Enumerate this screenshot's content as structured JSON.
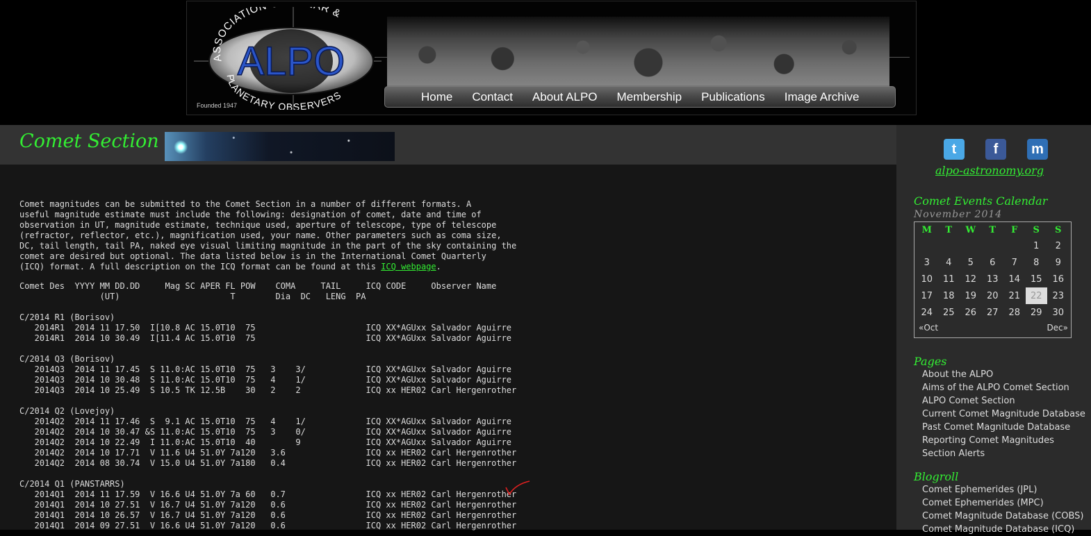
{
  "logo": {
    "arc_top": "ASSOCIATION OF LUNAR &",
    "arc_bottom": "PLANETARY OBSERVERS",
    "acronym": "ALPO",
    "founded": "Founded 1947"
  },
  "nav": {
    "items": [
      "Home",
      "Contact",
      "About ALPO",
      "Membership",
      "Publications",
      "Image Archive"
    ]
  },
  "section": {
    "title": "Comet Section"
  },
  "intro": {
    "text": "Comet magnitudes can be submitted to the Comet Section in a number of different formats. A\nuseful magnitude estimate must include the following: designation of comet, date and time of\nobservation in UT, magnitude estimate, technique used, aperture of telescope, type of telescope\n(refractor, reflector, etc.), magnification used, your name. Other parameters such as coma size,\nDC, tail length, tail PA, naked eye visual limiting magnitude in the part of the sky containing the\ncomet are desired but optional. The data listed below is in the International Comet Quarterly\n(ICQ) format. A full description on the ICQ format can be found at this ",
    "link_text": "ICQ webpage",
    "tail": "."
  },
  "table": {
    "header1": "Comet Des  YYYY MM DD.DD     Mag SC APER FL POW    COMA     TAIL     ICQ CODE     Observer Name",
    "header2": "                (UT)                      T        Dia  DC   LENG  PA",
    "groups": [
      {
        "name": "C/2014 R1 (Borisov)",
        "rows": [
          "   2014R1  2014 11 17.50  I[10.8 AC 15.0T10  75                      ICQ XX*AGUxx Salvador Aguirre",
          "   2014R1  2014 10 30.49  I[11.4 AC 15.0T10  75                      ICQ XX*AGUxx Salvador Aguirre"
        ]
      },
      {
        "name": "C/2014 Q3 (Borisov)",
        "rows": [
          "   2014Q3  2014 11 17.45  S 11.0:AC 15.0T10  75   3    3/            ICQ XX*AGUxx Salvador Aguirre",
          "   2014Q3  2014 10 30.48  S 11.0:AC 15.0T10  75   4    1/            ICQ XX*AGUxx Salvador Aguirre",
          "   2014Q3  2014 10 25.49  S 10.5 TK 12.5B    30   2    2             ICQ xx HER02 Carl Hergenrother"
        ]
      },
      {
        "name": "C/2014 Q2 (Lovejoy)",
        "rows": [
          "   2014Q2  2014 11 17.46  S  9.1 AC 15.0T10  75   4    1/            ICQ XX*AGUxx Salvador Aguirre",
          "   2014Q2  2014 10 30.47 &S 11.0:AC 15.0T10  75   3    0/            ICQ XX*AGUxx Salvador Aguirre",
          "   2014Q2  2014 10 22.49  I 11.0:AC 15.0T10  40        9             ICQ XX*AGUxx Salvador Aguirre",
          "   2014Q2  2014 10 17.71  V 11.6 U4 51.0Y 7a120   3.6                ICQ xx HER02 Carl Hergenrother",
          "   2014Q2  2014 08 30.74  V 15.0 U4 51.0Y 7a180   0.4                ICQ xx HER02 Carl Hergenrother"
        ]
      },
      {
        "name": "C/2014 Q1 (PANSTARRS)",
        "rows": [
          "   2014Q1  2014 11 17.59  V 16.6 U4 51.0Y 7a 60   0.7                ICQ xx HER02 Carl Hergenrother",
          "   2014Q1  2014 10 27.51  V 16.7 U4 51.0Y 7a120   0.6                ICQ xx HER02 Carl Hergenrother",
          "   2014Q1  2014 10 26.57  V 16.7 U4 51.0Y 7a120   0.6                ICQ xx HER02 Carl Hergenrother",
          "   2014Q1  2014 09 27.51  V 16.6 U4 51.0Y 7a120   0.6                ICQ xx HER02 Carl Hergenrother"
        ]
      }
    ]
  },
  "sidebar": {
    "social": [
      {
        "icon": "twitter-icon",
        "glyph": "t",
        "color": "#4aa8e6"
      },
      {
        "icon": "facebook-icon",
        "glyph": "f",
        "color": "#3b5998"
      },
      {
        "icon": "myspace-icon",
        "glyph": "m",
        "color": "#2f6fb5"
      }
    ],
    "site_link": "alpo-astronomy.org",
    "calendar": {
      "heading": "Comet Events Calendar",
      "month": "November 2014",
      "weekdays": [
        "M",
        "T",
        "W",
        "T",
        "F",
        "S",
        "S"
      ],
      "weeks": [
        [
          "",
          "",
          "",
          "",
          "",
          "1",
          "2"
        ],
        [
          "3",
          "4",
          "5",
          "6",
          "7",
          "8",
          "9"
        ],
        [
          "10",
          "11",
          "12",
          "13",
          "14",
          "15",
          "16"
        ],
        [
          "17",
          "18",
          "19",
          "20",
          "21",
          "22",
          "23"
        ],
        [
          "24",
          "25",
          "26",
          "27",
          "28",
          "29",
          "30"
        ]
      ],
      "today": "22",
      "prev": "«Oct",
      "next": "Dec»"
    },
    "pages": {
      "heading": "Pages",
      "items": [
        "About the ALPO",
        "Aims of the ALPO Comet Section",
        "ALPO Comet Section",
        "Current Comet Magnitude Database",
        "Past Comet Magnitude Database",
        "Reporting Comet Magnitudes",
        "Section Alerts"
      ]
    },
    "blogroll": {
      "heading": "Blogroll",
      "items": [
        "Comet Ephemerides (JPL)",
        "Comet Ephemerides (MPC)",
        "Comet Magnitude Database (COBS)",
        "Comet Magnitude Database (ICQ)"
      ]
    }
  },
  "colors": {
    "accent_green": "#33ee33",
    "annotation_red": "#e02020",
    "logo_blue": "#2a55c8"
  }
}
